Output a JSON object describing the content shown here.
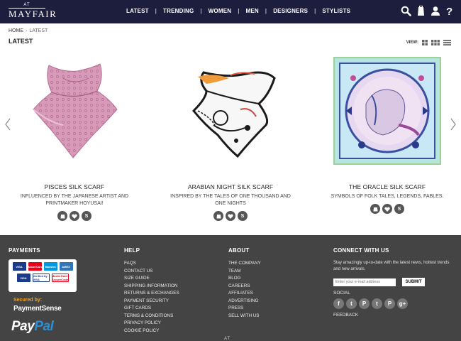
{
  "header": {
    "logo_top": "AT",
    "logo_name": "MAYFAIR",
    "nav": [
      "LATEST",
      "TRENDING",
      "WOMEN",
      "MEN",
      "DESIGNERS",
      "STYLISTS"
    ],
    "icons": [
      "search-icon",
      "bag-icon",
      "user-icon",
      "help-icon"
    ]
  },
  "breadcrumb": {
    "home": "HOME",
    "separator": "›",
    "current": "LATEST"
  },
  "page_title": "LATEST",
  "view": {
    "label": "VIEW:",
    "options": [
      "grid-small-icon",
      "grid-large-icon",
      "list-icon"
    ]
  },
  "products": [
    {
      "name": "PISCES SILK SCARF",
      "desc1": "INFLUENCED BY THE JAPANESE ARTIST AND",
      "desc2": "PRINTMAKER HOYUSAI!",
      "actions": [
        "",
        "",
        "S"
      ]
    },
    {
      "name": "ARABIAN NIGHT SILK SCARF",
      "desc1": "INSPIRED BY THE TALES OF ONE THOUSAND AND",
      "desc2": "ONE NIGHTS",
      "actions": [
        "",
        "",
        "S"
      ]
    },
    {
      "name": "THE ORACLE SILK SCARF",
      "desc1": "SYMBOLS OF FOLK TALES, LEGENDS, FABLES.",
      "desc2": "",
      "actions": [
        "",
        "",
        "S"
      ]
    }
  ],
  "footer": {
    "payments": {
      "heading": "PAYMENTS",
      "cards_row1": [
        "VISA",
        "MasterCard",
        "Maestro",
        "AMEX"
      ],
      "cards_row2": [
        "VISA",
        "Verified by VISA",
        "MasterCard SecureCode"
      ],
      "secured_by": "Secured by:",
      "paymentsense": "PaymentSense",
      "paypal_pay": "Pay",
      "paypal_pal": "Pal"
    },
    "help": {
      "heading": "HELP",
      "links": [
        "FAQS",
        "CONTACT US",
        "SIZE GUIDE",
        "SHIPPING INFORMATION",
        "RETURNS & EXCHANGES",
        "PAYMENT SECURITY",
        "GIFT CARDS",
        "TERMS & CONDITIONS",
        "PRIVACY POLICY",
        "COOKIE POLICY"
      ]
    },
    "about": {
      "heading": "ABOUT",
      "links": [
        "THE COMPANY",
        "TEAM",
        "BLOG",
        "CAREERS",
        "AFFILIATES",
        "ADVERTISING",
        "PRESS",
        "SELL WITH US"
      ]
    },
    "connect": {
      "heading": "CONNECT WITH US",
      "text": "Stay amazingly up-to-date with the latest news, hottest trends and new arrivals.",
      "email_placeholder": "Enter your e-mail address",
      "submit_label": "SUBMIT",
      "social_label": "SOCIAL",
      "social": [
        "f",
        "t",
        "P",
        "t",
        "P",
        "g+"
      ],
      "feedback": "FEEDBACK"
    },
    "bottom_logo": "AT"
  },
  "colors": {
    "header_bg": "#1d1d3d",
    "footer_bg": "#444444",
    "button_dark": "#555555"
  }
}
